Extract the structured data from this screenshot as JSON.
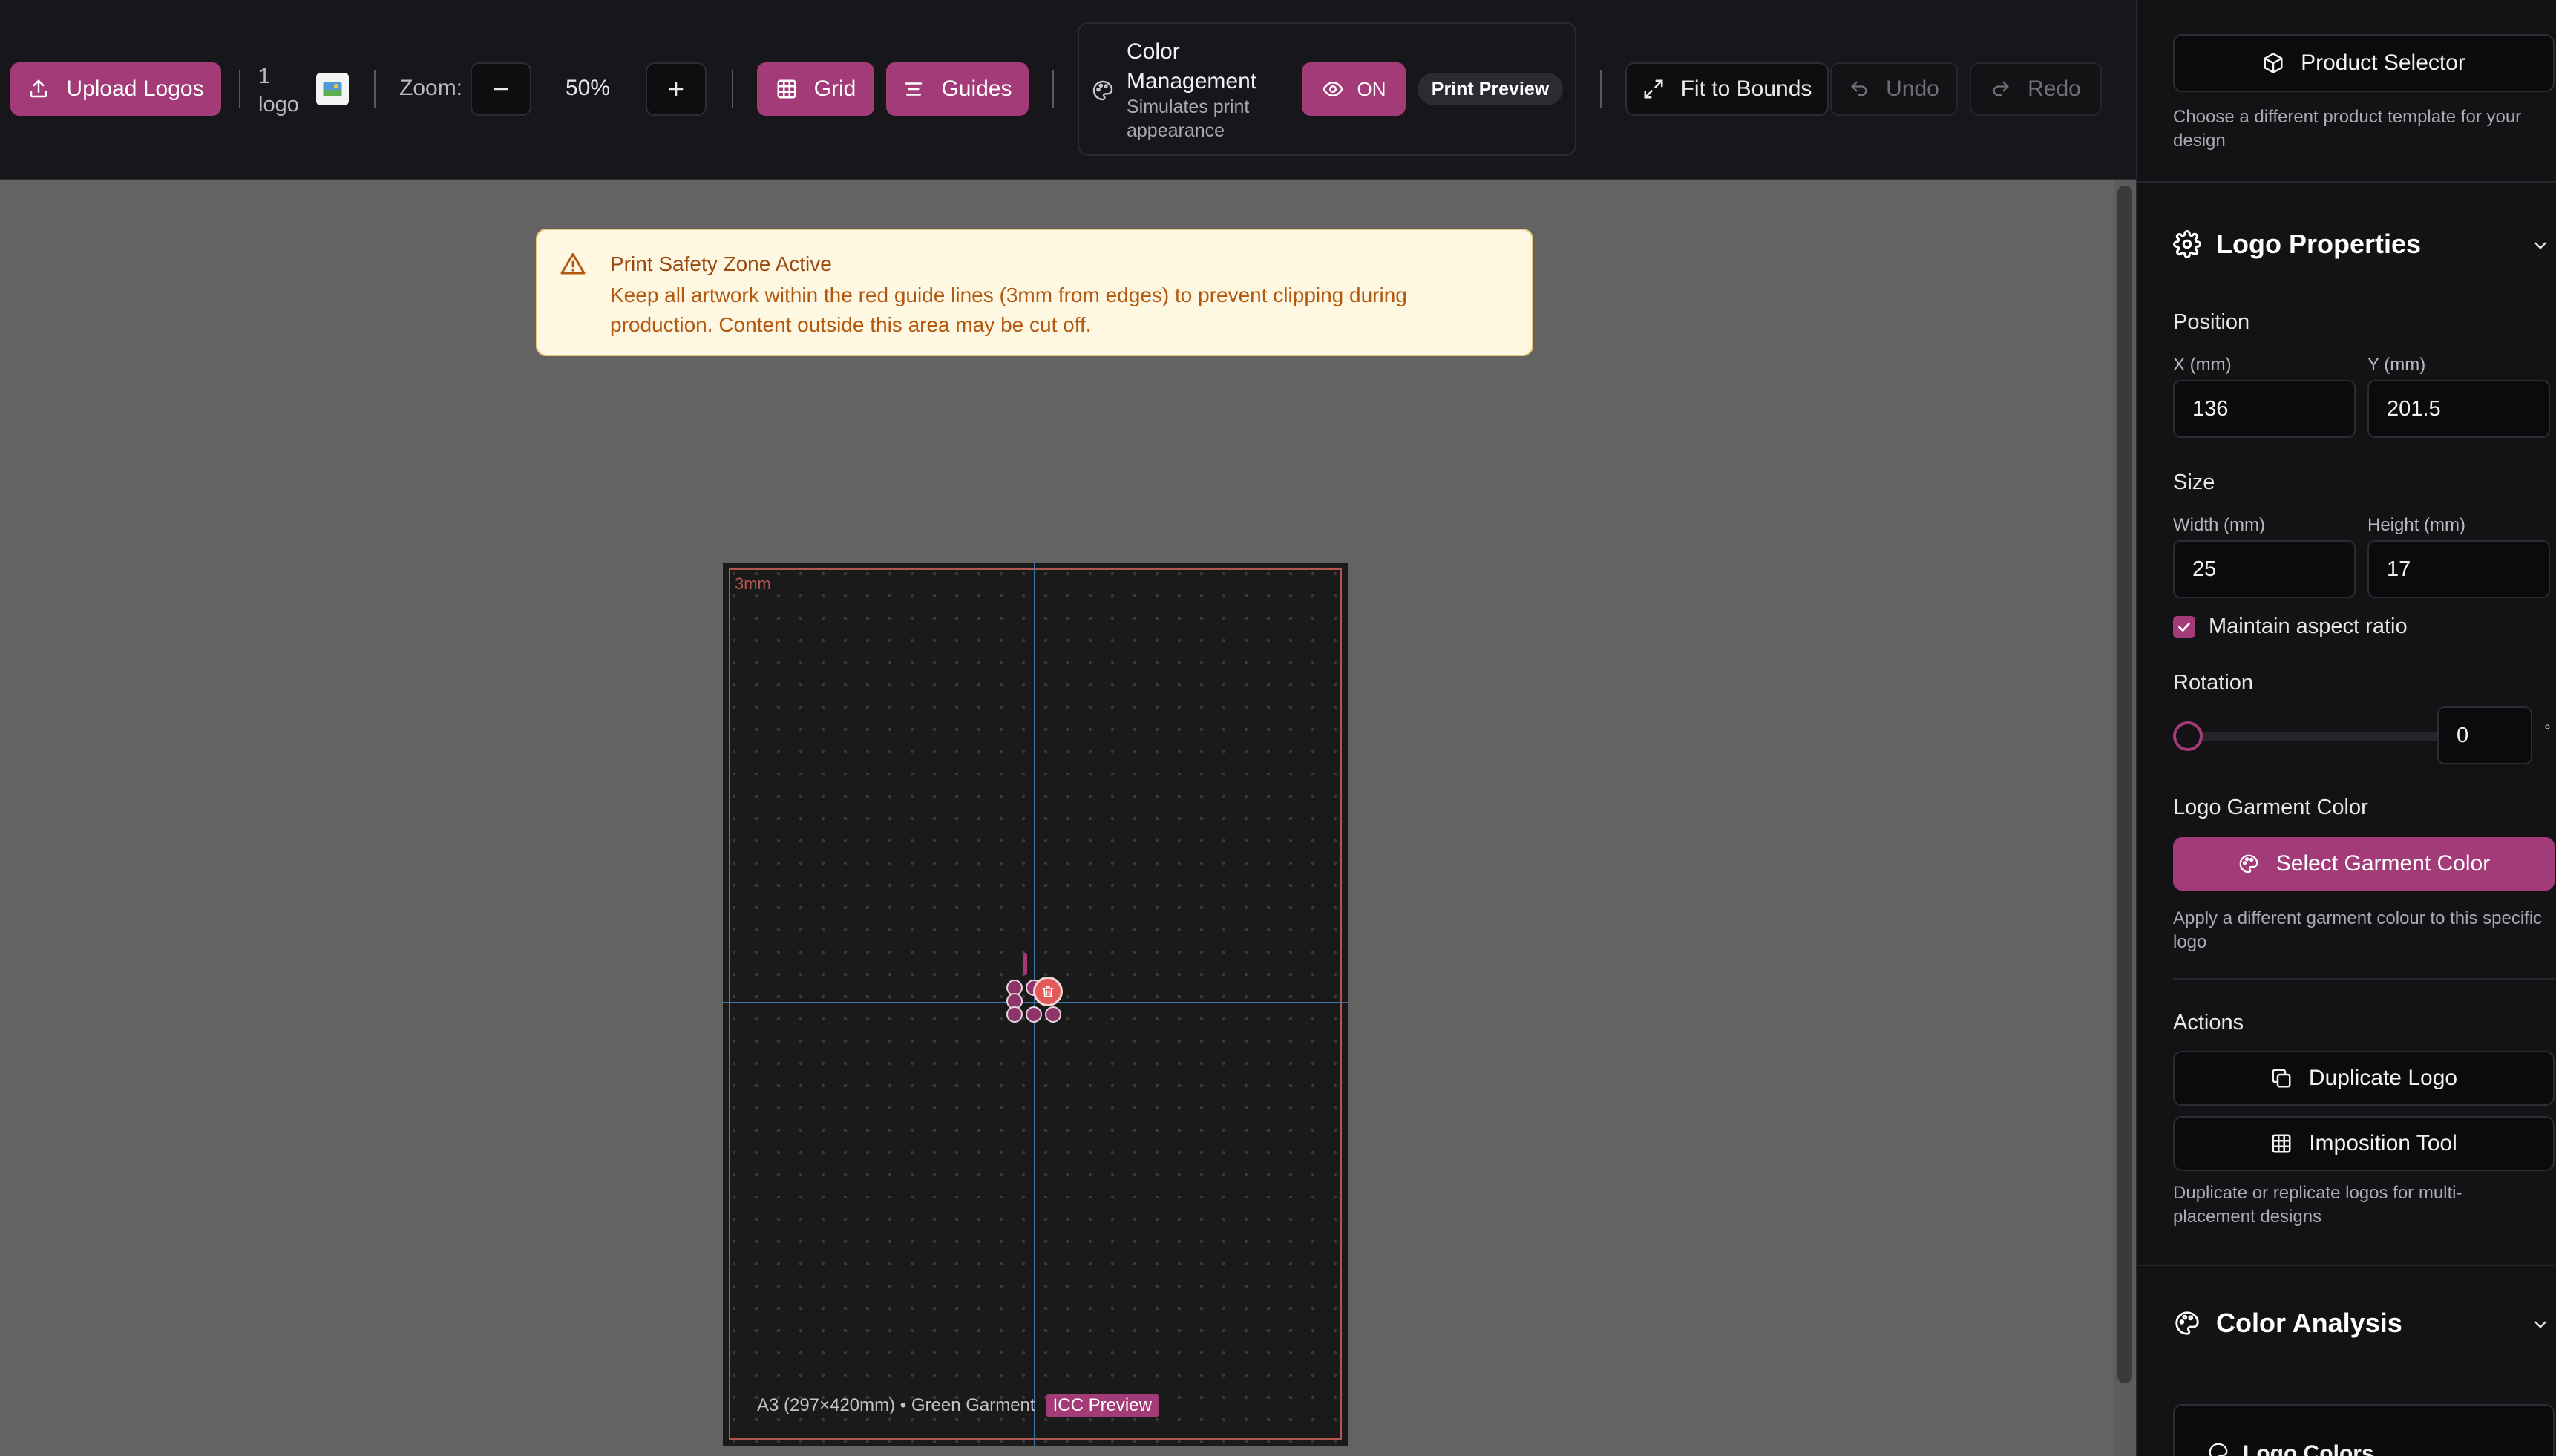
{
  "toolbar": {
    "upload_label": "Upload Logos",
    "logo_count_num": "1",
    "logo_count_unit": "logo",
    "zoom_label": "Zoom:",
    "zoom_value": "50%",
    "grid_label": "Grid",
    "guides_label": "Guides",
    "color_mgmt_title": "Color Management",
    "color_mgmt_sub": "Simulates print appearance",
    "toggle_label": "ON",
    "print_preview_label": "Print Preview",
    "fit_label": "Fit to Bounds",
    "undo_label": "Undo",
    "redo_label": "Redo"
  },
  "warning": {
    "title": "Print Safety Zone Active",
    "body": "Keep all artwork within the red guide lines (3mm from edges) to prevent clipping during production. Content outside this area may be cut off."
  },
  "artboard": {
    "safe_label": "3mm",
    "info": "A3 (297×420mm) • Green Garment",
    "badge": "ICC Preview"
  },
  "panel": {
    "product_selector_label": "Product Selector",
    "product_selector_hint": "Choose a different product template for your design",
    "logo_props_title": "Logo Properties",
    "position_label": "Position",
    "x_label": "X (mm)",
    "x_value": "136",
    "y_label": "Y (mm)",
    "y_value": "201.5",
    "size_label": "Size",
    "width_label": "Width (mm)",
    "width_value": "25",
    "height_label": "Height (mm)",
    "height_value": "17",
    "aspect_label": "Maintain aspect ratio",
    "rotation_label": "Rotation",
    "rotation_value": "0",
    "rotation_unit": "°",
    "garment_color_label": "Logo Garment Color",
    "select_garment_label": "Select Garment Color",
    "garment_hint": "Apply a different garment colour to this specific logo",
    "actions_label": "Actions",
    "duplicate_label": "Duplicate Logo",
    "imposition_label": "Imposition Tool",
    "actions_hint": "Duplicate or replicate logos for multi-placement designs",
    "color_analysis_title": "Color Analysis",
    "logo_colors_label": "Logo Colors"
  },
  "colors": {
    "accent": "#a33b78",
    "warning_bg": "#fef7e2",
    "guide_red": "#b2564f",
    "guide_blue": "#3f74a8"
  }
}
